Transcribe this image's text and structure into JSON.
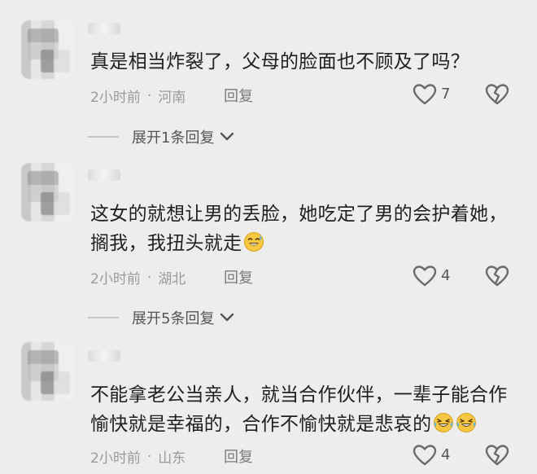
{
  "comments": [
    {
      "text": "真是相当炸裂了，父母的脸面也不顾及了吗？",
      "time": "2小时前",
      "location": "河南",
      "reply_label": "回复",
      "likes": "7",
      "show_like_count": true,
      "expand_label": "展开1条回复"
    },
    {
      "text_line1": "这女的就想让男的丢脸，她吃定了男的会护着她，",
      "text_line2": "搁我，我扭头就走",
      "time": "2小时前",
      "location": "湖北",
      "reply_label": "回复",
      "likes": "4",
      "expand_label": "展开5条回复",
      "emoji": "sweat-smile-emoji"
    },
    {
      "text_line1": "不能拿老公当亲人，就当合作伙伴，一辈子能合作",
      "text_line2": "愉快就是幸福的，合作不愉快就是悲哀的",
      "time": "2小时前",
      "location": "山东",
      "reply_label": "回复",
      "likes": "4",
      "emoji": "laugh-cry-emoji"
    }
  ],
  "separator": "·",
  "colors": {
    "background": "#ededed",
    "text": "#202020",
    "meta": "#9a9a9a",
    "emoji": "#f7c744"
  }
}
